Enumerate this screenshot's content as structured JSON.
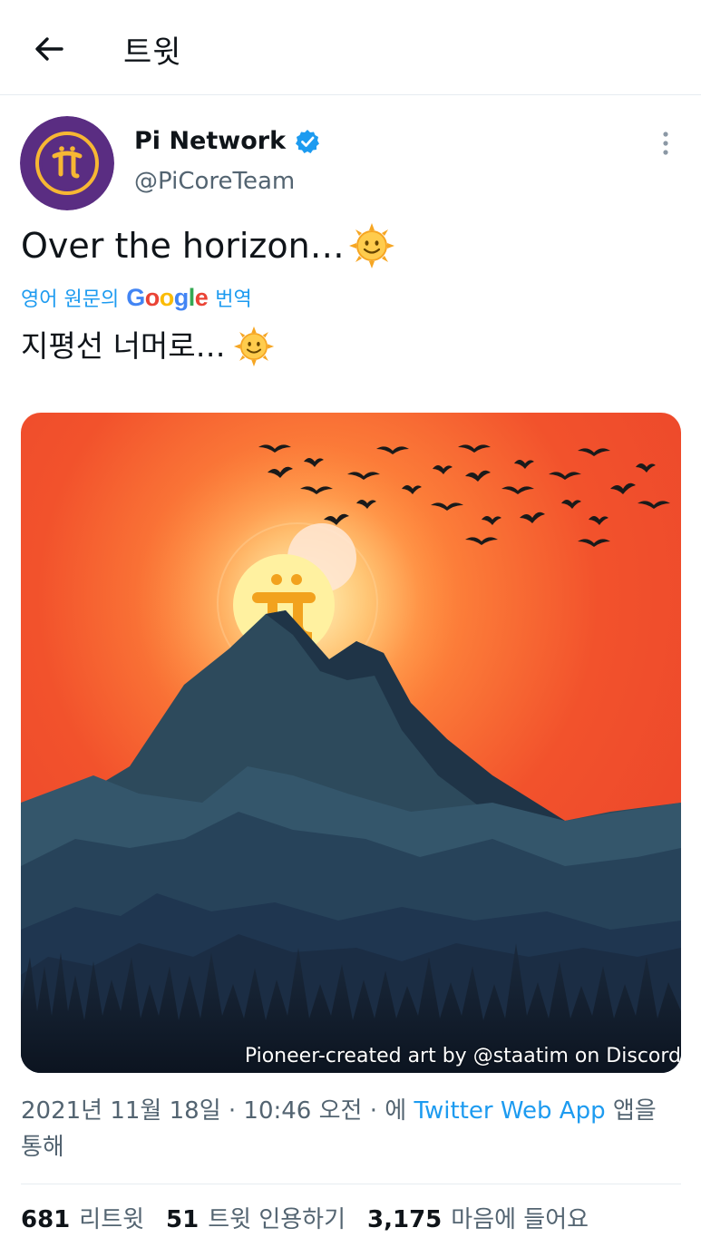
{
  "header": {
    "title": "트윗"
  },
  "tweet": {
    "author_name": "Pi Network",
    "author_handle": "@PiCoreTeam",
    "text": "Over the horizon…",
    "translate": {
      "prefix": "영어 원문의",
      "google": "Google",
      "suffix": "번역"
    },
    "translated_text": "지평선 너머로…",
    "media_caption": "Pioneer-created art by @staatim on Discord",
    "timestamp": "2021년 11월 18일 · 10:46 오전 · 에",
    "source": "Twitter Web App",
    "timestamp_suffix": "앱을 통해"
  },
  "stats": {
    "retweets_count": "681",
    "retweets_label": "리트윗",
    "quotes_count": "51",
    "quotes_label": "트윗 인용하기",
    "likes_count": "3,175",
    "likes_label": "마음에 들어요"
  },
  "colors": {
    "accent": "#1d9bf0",
    "verified": "#1d9bf0",
    "avatar_bg": "#5a2d82",
    "avatar_ring": "#f7b733"
  },
  "icons": {
    "back": "arrow-left-icon",
    "verified": "verified-badge-icon",
    "more": "more-vertical-icon",
    "sun": "sun-with-face-emoji"
  }
}
